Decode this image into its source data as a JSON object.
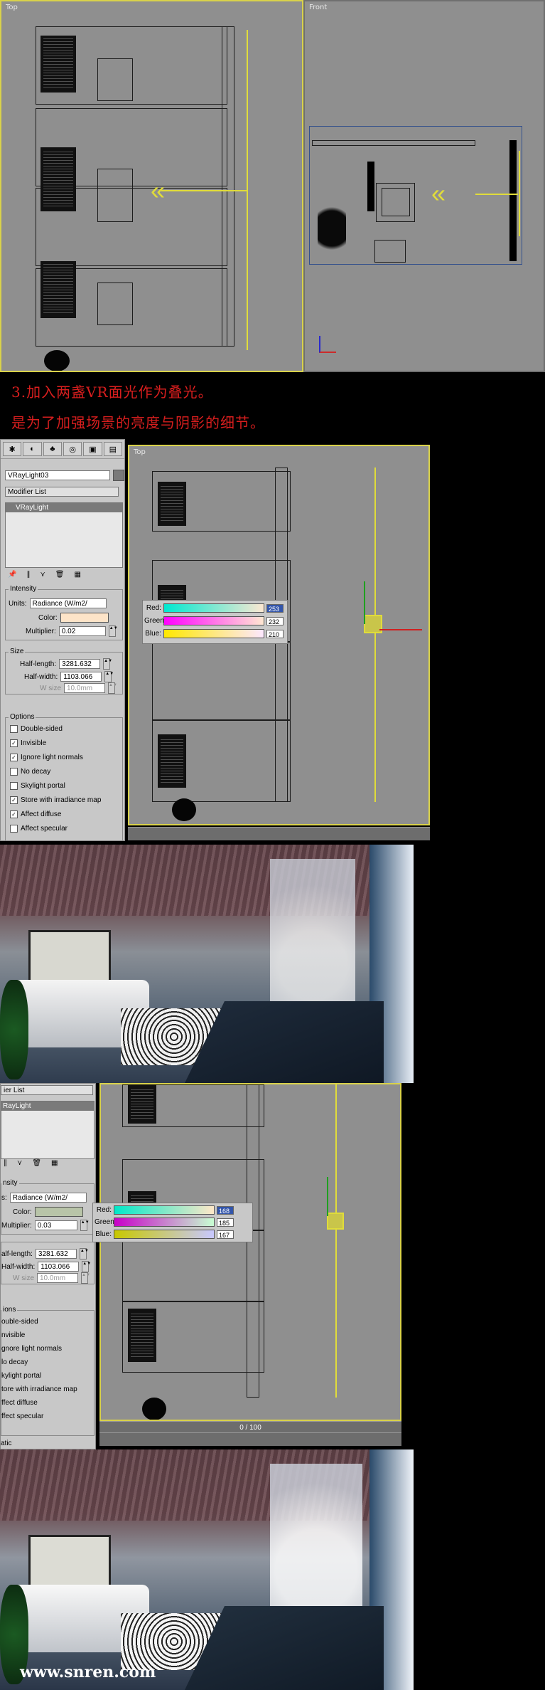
{
  "viewports": {
    "top_label": "Top",
    "front_label": "Front"
  },
  "caption": {
    "line1": "3.加入两盏VR面光作为叠光。",
    "line2": "是为了加强场景的亮度与阴影的细节。"
  },
  "panel1": {
    "object_name": "VRayLight03",
    "modifier_list": "Modifier List",
    "stack_item": "VRayLight",
    "intensity": {
      "title": "Intensity",
      "units_label": "Units:",
      "units_value": "Radiance (W/m2/",
      "color_label": "Color:",
      "color_hex": "#fde4c8",
      "multiplier_label": "Multiplier:",
      "multiplier_value": "0.02"
    },
    "size": {
      "title": "Size",
      "half_length_label": "Half-length:",
      "half_length_value": "3281.632",
      "half_width_label": "Half-width:",
      "half_width_value": "1103.066",
      "w_size_label": "W size",
      "w_size_value": "10.0mm"
    },
    "options": {
      "title": "Options",
      "items": [
        {
          "label": "Double-sided",
          "checked": false
        },
        {
          "label": "Invisible",
          "checked": true
        },
        {
          "label": "Ignore light normals",
          "checked": true
        },
        {
          "label": "No decay",
          "checked": false
        },
        {
          "label": "Skylight portal",
          "checked": false
        },
        {
          "label": "Store with irradiance map",
          "checked": true
        },
        {
          "label": "Affect diffuse",
          "checked": true
        },
        {
          "label": "Affect specular",
          "checked": false
        }
      ]
    },
    "picker": {
      "red_label": "Red:",
      "red_value": "253",
      "green_label": "Green:",
      "green_value": "232",
      "blue_label": "Blue:",
      "blue_value": "210"
    },
    "viewport_label": "Top"
  },
  "panel2": {
    "modifier_list": "ier List",
    "stack_item": "RayLight",
    "intensity": {
      "title": "nsity",
      "units_label": "s:",
      "units_value": "Radiance (W/m2/",
      "color_label": "Color:",
      "color_hex": "#b8c4a8",
      "multiplier_label": "Multiplier:",
      "multiplier_value": "0.03"
    },
    "size": {
      "half_length_label": "alf-length:",
      "half_length_value": "3281.632",
      "half_width_label": "Half-width:",
      "half_width_value": "1103.066",
      "w_size_label": "W size",
      "w_size_value": "10.0mm"
    },
    "options": {
      "title": "ions",
      "items": [
        {
          "label": "ouble-sided"
        },
        {
          "label": "nvisible"
        },
        {
          "label": "gnore light normals"
        },
        {
          "label": "lo decay"
        },
        {
          "label": "kylight portal"
        },
        {
          "label": "tore with irradiance map"
        },
        {
          "label": "ffect diffuse"
        },
        {
          "label": "ffect specular"
        }
      ]
    },
    "picker": {
      "red_label": "Red:",
      "red_value": "168",
      "green_label": "Green:",
      "green_value": "185",
      "blue_label": "Blue:",
      "blue_value": "167"
    },
    "timeline": "0 / 100",
    "bottom_cut": "atic"
  },
  "watermark": "www.snren.com",
  "colors": {
    "caption": "#d81e1e",
    "viewport_bg": "#8f8f8f",
    "active_border": "#d9d24a"
  }
}
